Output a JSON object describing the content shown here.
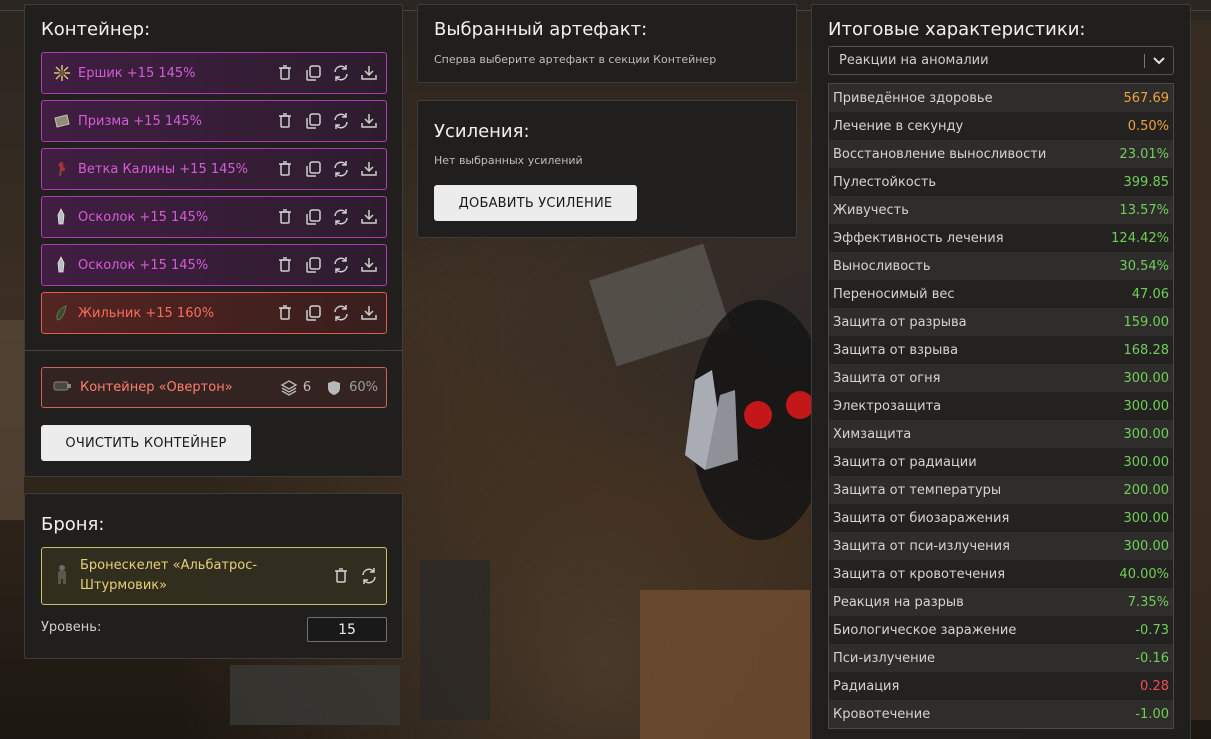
{
  "container_panel": {
    "title": "Контейнер:",
    "artifacts": [
      {
        "name": "Ершик +15 145%",
        "color": "#d65bd9",
        "icon": "ershik-artifact-icon"
      },
      {
        "name": "Призма +15 145%",
        "color": "#d65bd9",
        "icon": "prism-artifact-icon"
      },
      {
        "name": "Ветка Калины +15 145%",
        "color": "#d65bd9",
        "icon": "kalina-branch-artifact-icon"
      },
      {
        "name": "Осколок +15 145%",
        "color": "#d65bd9",
        "icon": "shard-artifact-icon"
      },
      {
        "name": "Осколок +15 145%",
        "color": "#d65bd9",
        "icon": "shard-artifact-icon"
      },
      {
        "name": "Жильник +15 160%",
        "color": "#ff6a5e",
        "icon": "zhilnik-artifact-icon"
      }
    ],
    "container": {
      "name": "Контейнер «Овертон»",
      "slots": "6",
      "protection": "60%"
    },
    "clear_button": "ОЧИСТИТЬ КОНТЕЙНЕР"
  },
  "armor_panel": {
    "title": "Броня:",
    "armor_name": "Бронескелет «Альбатрос-Штурмовик»",
    "level_label": "Уровень:",
    "level_value": "15"
  },
  "selected_artifact_panel": {
    "title": "Выбранный артефакт:",
    "hint": "Сперва выберите артефакт в секции Контейнер"
  },
  "boosts_panel": {
    "title": "Усиления:",
    "empty_text": "Нет выбранных усилений",
    "add_button": "ДОБАВИТЬ УСИЛЕНИЕ"
  },
  "stats_panel": {
    "title": "Итоговые характеристики:",
    "select_value": "Реакции на аномалии",
    "rows": [
      {
        "label": "Приведённое здоровье",
        "value": "567.69",
        "tone": "orange"
      },
      {
        "label": "Лечение в секунду",
        "value": "0.50%",
        "tone": "orange"
      },
      {
        "label": "Восстановление выносливости",
        "value": "23.01%",
        "tone": "green"
      },
      {
        "label": "Пулестойкость",
        "value": "399.85",
        "tone": "green"
      },
      {
        "label": "Живучесть",
        "value": "13.57%",
        "tone": "green"
      },
      {
        "label": "Эффективность лечения",
        "value": "124.42%",
        "tone": "green"
      },
      {
        "label": "Выносливость",
        "value": "30.54%",
        "tone": "green"
      },
      {
        "label": "Переносимый вес",
        "value": "47.06",
        "tone": "green"
      },
      {
        "label": "Защита от разрыва",
        "value": "159.00",
        "tone": "green"
      },
      {
        "label": "Защита от взрыва",
        "value": "168.28",
        "tone": "green"
      },
      {
        "label": "Защита от огня",
        "value": "300.00",
        "tone": "green"
      },
      {
        "label": "Электрозащита",
        "value": "300.00",
        "tone": "green"
      },
      {
        "label": "Химзащита",
        "value": "300.00",
        "tone": "green"
      },
      {
        "label": "Защита от радиации",
        "value": "300.00",
        "tone": "green"
      },
      {
        "label": "Защита от температуры",
        "value": "200.00",
        "tone": "green"
      },
      {
        "label": "Защита от биозаражения",
        "value": "300.00",
        "tone": "green"
      },
      {
        "label": "Защита от пси-излучения",
        "value": "300.00",
        "tone": "green"
      },
      {
        "label": "Защита от кровотечения",
        "value": "40.00%",
        "tone": "green"
      },
      {
        "label": "Реакция на разрыв",
        "value": "7.35%",
        "tone": "green"
      },
      {
        "label": "Биологическое заражение",
        "value": "-0.73",
        "tone": "green"
      },
      {
        "label": "Пси-излучение",
        "value": "-0.16",
        "tone": "green"
      },
      {
        "label": "Радиация",
        "value": "0.28",
        "tone": "red"
      },
      {
        "label": "Кровотечение",
        "value": "-1.00",
        "tone": "green"
      }
    ]
  },
  "colors": {
    "epic": "#d65bd9",
    "legendary": "#ff6a5e",
    "positive": "#6fcf59",
    "highlight": "#f0a23a",
    "negative": "#ef4e4e",
    "armor_border": "#c9c06a"
  }
}
